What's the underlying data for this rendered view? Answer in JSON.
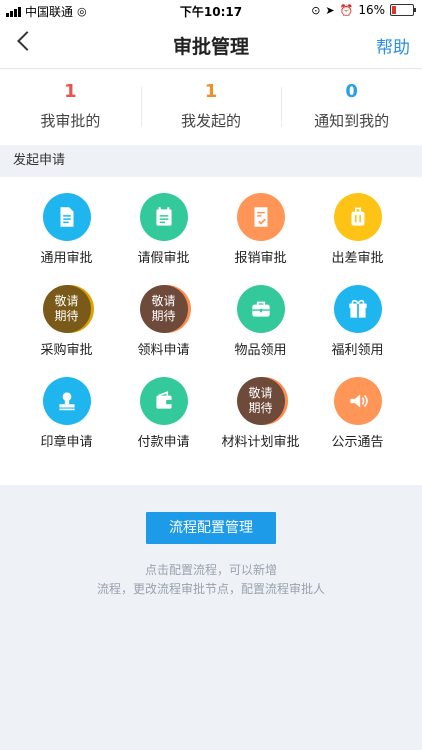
{
  "statusbar": {
    "carrier": "中国联通",
    "time": "下午10:17",
    "battery": "16%"
  },
  "navbar": {
    "title": "审批管理",
    "help": "帮助"
  },
  "stats": [
    {
      "num": "1",
      "label": "我审批的",
      "color": "#e8534e"
    },
    {
      "num": "1",
      "label": "我发起的",
      "color": "#f0902c"
    },
    {
      "num": "0",
      "label": "通知到我的",
      "color": "#2aa0e6"
    }
  ],
  "section": {
    "title": "发起申请"
  },
  "apps": [
    {
      "label": "通用审批",
      "icon": "document-icon",
      "color": "#1fb6ef"
    },
    {
      "label": "请假审批",
      "icon": "calendar-icon",
      "color": "#33c99a"
    },
    {
      "label": "报销审批",
      "icon": "receipt-check-icon",
      "color": "#ff9557"
    },
    {
      "label": "出差审批",
      "icon": "luggage-icon",
      "color": "#ffc316"
    },
    {
      "label": "采购审批",
      "icon": "coming-soon-icon",
      "placeholder_top": "敬请",
      "placeholder_bottom": "期待",
      "color": "#7a5a18"
    },
    {
      "label": "领料申请",
      "icon": "coming-soon-icon",
      "placeholder_top": "敬请",
      "placeholder_bottom": "期待",
      "color": "#6e4a3a"
    },
    {
      "label": "物品领用",
      "icon": "briefcase-icon",
      "color": "#33c99a"
    },
    {
      "label": "福利领用",
      "icon": "gift-icon",
      "color": "#1fb6ef"
    },
    {
      "label": "印章申请",
      "icon": "stamp-icon",
      "color": "#1fb6ef"
    },
    {
      "label": "付款申请",
      "icon": "wallet-icon",
      "color": "#33c99a"
    },
    {
      "label": "材料计划审批",
      "icon": "coming-soon-icon",
      "placeholder_top": "敬请",
      "placeholder_bottom": "期待",
      "color": "#6e4a3a"
    },
    {
      "label": "公示通告",
      "icon": "speaker-icon",
      "color": "#ff9557"
    }
  ],
  "config": {
    "button": "流程配置管理",
    "hint_line1": "点击配置流程，可以新增",
    "hint_line2": "流程，更改流程审批节点，配置流程审批人"
  }
}
